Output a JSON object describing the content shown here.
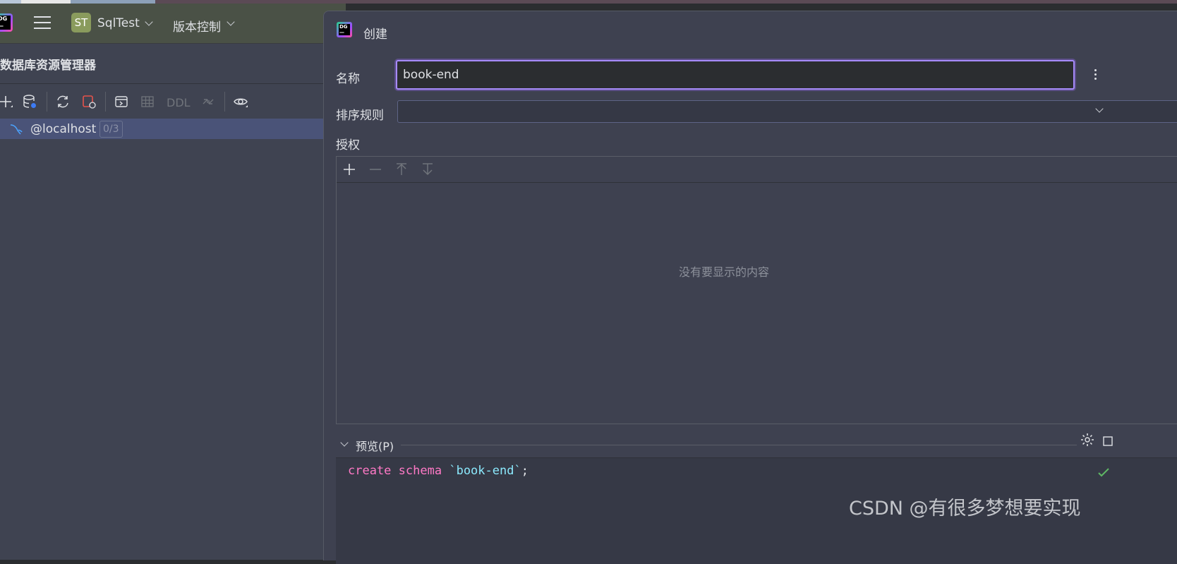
{
  "header": {
    "project_badge": "ST",
    "project_name": "SqlTest",
    "vcs_label": "版本控制"
  },
  "explorer": {
    "title": "数据库资源管理器",
    "toolbar": {
      "ddl_label": "DDL",
      "icons": [
        "add-icon",
        "datasource-properties-icon",
        "refresh-icon",
        "disconnect-icon",
        "jump-to-console-icon",
        "table-icon",
        "compare-icon",
        "view-options-icon"
      ]
    },
    "tree": [
      {
        "label": "@localhost",
        "count": "0/3",
        "icon": "mysql-icon"
      }
    ]
  },
  "dialog": {
    "title": "创建",
    "name_label": "名称",
    "name_value": "book-end",
    "collation_label": "排序规则",
    "collation_value": "",
    "grants_label": "授权",
    "grants_empty": "没有要显示的内容",
    "grants_toolbar": [
      "add-icon",
      "remove-icon",
      "move-up-icon",
      "move-down-icon"
    ],
    "preview_label": "预览(P)",
    "preview_code": {
      "kw1": "create",
      "kw2": "schema",
      "ident": "`book-end`",
      "end": ";"
    }
  },
  "watermark": "CSDN @有很多梦想要实现",
  "colors": {
    "accent_focus": "#a78bfa",
    "selection": "#4a5378",
    "keyword": "#ff79c6",
    "identifier": "#8be9fd"
  }
}
